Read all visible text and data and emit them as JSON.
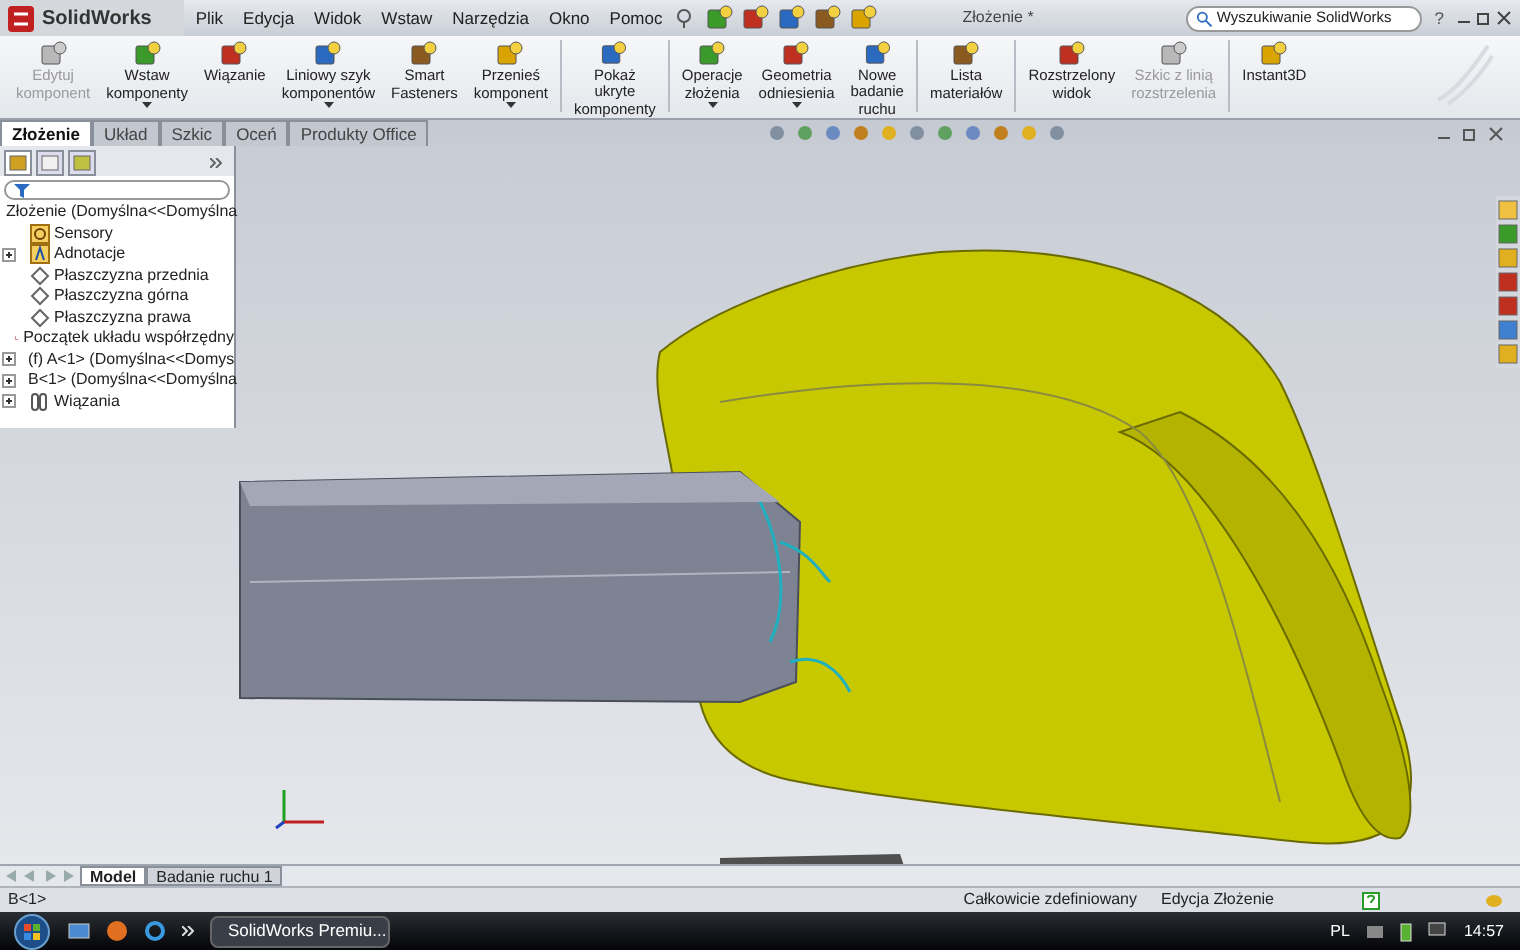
{
  "app": {
    "logo": "SolidWorks",
    "menu": [
      "Plik",
      "Edycja",
      "Widok",
      "Wstaw",
      "Narzędzia",
      "Okno",
      "Pomoc"
    ],
    "title": "Złożenie *",
    "search": {
      "placeholder": "Wyszukiwanie SolidWorks"
    },
    "help": "?"
  },
  "ribbon_groups": [
    {
      "buttons": [
        {
          "label": "Edytuj\nkomponent",
          "disabled": true,
          "dropdown": false
        },
        {
          "label": "Wstaw\nkomponenty",
          "disabled": false,
          "dropdown": true
        },
        {
          "label": "Wiązanie",
          "disabled": false,
          "dropdown": false
        },
        {
          "label": "Liniowy szyk\nkomponentów",
          "disabled": false,
          "dropdown": true
        },
        {
          "label": "Smart\nFasteners",
          "disabled": false,
          "dropdown": false
        },
        {
          "label": "Przenieś\nkomponent",
          "disabled": false,
          "dropdown": true
        }
      ]
    },
    {
      "buttons": [
        {
          "label": "Pokaż\nukryte\nkomponenty",
          "disabled": false,
          "dropdown": false
        }
      ]
    },
    {
      "buttons": [
        {
          "label": "Operacje\nzłożenia",
          "disabled": false,
          "dropdown": true
        },
        {
          "label": "Geometria\nodniesienia",
          "disabled": false,
          "dropdown": true
        },
        {
          "label": "Nowe\nbadanie\nruchu",
          "disabled": false,
          "dropdown": false
        }
      ]
    },
    {
      "buttons": [
        {
          "label": "Lista\nmateriałów",
          "disabled": false,
          "dropdown": false
        }
      ]
    },
    {
      "buttons": [
        {
          "label": "Rozstrzelony\nwidok",
          "disabled": false,
          "dropdown": false
        },
        {
          "label": "Szkic z linią\nrozstrzelenia",
          "disabled": true,
          "dropdown": false
        }
      ]
    },
    {
      "buttons": [
        {
          "label": "Instant3D",
          "disabled": false,
          "dropdown": false
        }
      ]
    }
  ],
  "tabs": [
    {
      "label": "Złożenie",
      "selected": true
    },
    {
      "label": "Układ",
      "selected": false
    },
    {
      "label": "Szkic",
      "selected": false
    },
    {
      "label": "Oceń",
      "selected": false
    },
    {
      "label": "Produkty Office",
      "selected": false
    }
  ],
  "tree": {
    "root": "Złożenie  (Domyślna<<Domyślna",
    "children": [
      {
        "label": "Sensory",
        "kind": "sensor",
        "expandable": false
      },
      {
        "label": "Adnotacje",
        "kind": "annotation",
        "expandable": true
      },
      {
        "label": "Płaszczyzna przednia",
        "kind": "plane",
        "expandable": false
      },
      {
        "label": "Płaszczyzna górna",
        "kind": "plane",
        "expandable": false
      },
      {
        "label": "Płaszczyzna prawa",
        "kind": "plane",
        "expandable": false
      },
      {
        "label": "Początek układu współrzędny",
        "kind": "origin",
        "expandable": false
      },
      {
        "label": "(f) A<1> (Domyślna<<Domys",
        "kind": "part",
        "expandable": true
      },
      {
        "label": "B<1> (Domyślna<<Domyślna",
        "kind": "part",
        "expandable": true
      },
      {
        "label": "Wiązania",
        "kind": "mates",
        "expandable": true
      }
    ]
  },
  "view_tabs": [
    {
      "label": "Model",
      "selected": true
    },
    {
      "label": "Badanie ruchu 1",
      "selected": false
    }
  ],
  "status_bar": {
    "selection": "B<1>",
    "state": "Całkowicie zdefiniowany",
    "mode": "Edycja Złożenie"
  },
  "taskbar": {
    "task": "SolidWorks Premiu...",
    "language": "PL",
    "time": "14:57"
  }
}
